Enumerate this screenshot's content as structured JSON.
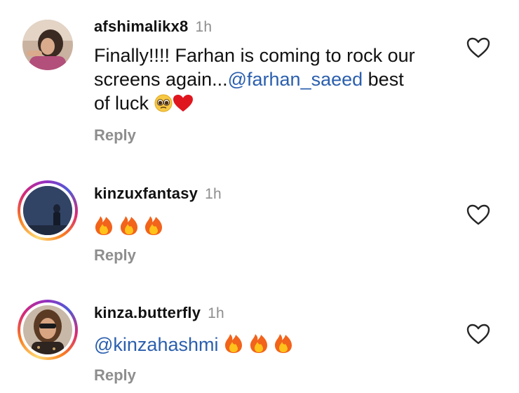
{
  "comments": [
    {
      "username": "afshimalikx8",
      "time": "1h",
      "text_line1": "Finally!!!! Farhan is coming to rock our",
      "text_line2_prefix": "screens again...",
      "mention": "@farhan_saeed",
      "text_line2_suffix": " best",
      "text_line3": "of luck",
      "emoji": [
        "pleading-face",
        "red-heart"
      ],
      "reply_label": "Reply"
    },
    {
      "username": "kinzuxfantasy",
      "time": "1h",
      "emoji": [
        "fire",
        "fire",
        "fire"
      ],
      "reply_label": "Reply"
    },
    {
      "username": "kinza.butterfly",
      "time": "1h",
      "mention": "@kinzahashmi",
      "emoji": [
        "fire",
        "fire",
        "fire"
      ],
      "reply_label": "Reply"
    }
  ],
  "colors": {
    "mention": "#2b5fae",
    "secondary_text": "#8e8e8e",
    "heart_emoji": "#e0161f",
    "fire": "#f2631b"
  }
}
